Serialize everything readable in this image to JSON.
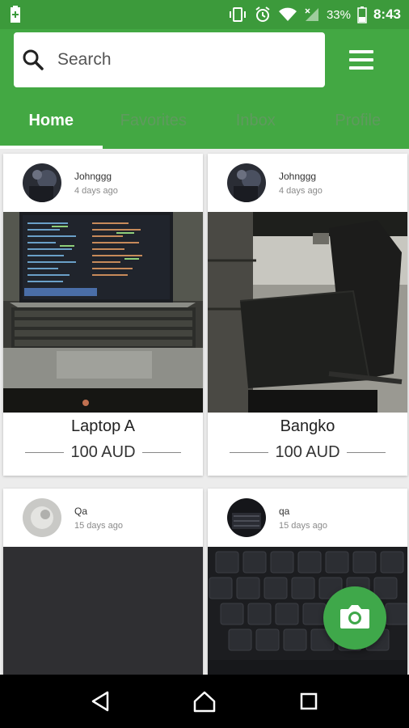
{
  "status_bar": {
    "battery_percent": "33%",
    "time": "8:43",
    "icons": [
      "battery-saver-icon",
      "vibrate-icon",
      "alarm-icon",
      "wifi-icon",
      "signal-icon",
      "battery-icon"
    ]
  },
  "search": {
    "placeholder": "Search",
    "value": ""
  },
  "tabs": [
    {
      "label": "Home",
      "active": true
    },
    {
      "label": "Favorites",
      "active": false
    },
    {
      "label": "Inbox",
      "active": false
    },
    {
      "label": "Profile",
      "active": false
    }
  ],
  "listings": [
    {
      "user": "Johnggg",
      "time": "4 days ago",
      "title": "Laptop A",
      "price": "100 AUD"
    },
    {
      "user": "Johnggg",
      "time": "4 days ago",
      "title": "Bangko",
      "price": "100 AUD"
    },
    {
      "user": "Qa",
      "time": "15 days ago",
      "title": "",
      "price": ""
    },
    {
      "user": "qa",
      "time": "15 days ago",
      "title": "",
      "price": ""
    }
  ],
  "colors": {
    "primary": "#43a843",
    "status_bar": "#3c9a3b",
    "tab_inactive": "#5f9a5e",
    "fab": "#3fa84a"
  }
}
